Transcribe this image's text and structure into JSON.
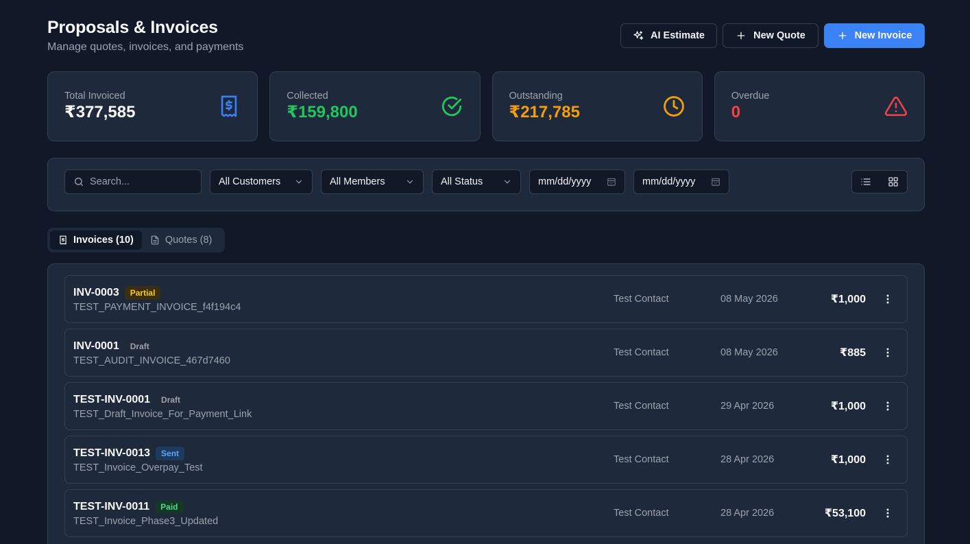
{
  "header": {
    "title": "Proposals & Invoices",
    "subtitle": "Manage quotes, invoices, and payments",
    "ai_estimate_label": "AI Estimate",
    "new_quote_label": "New Quote",
    "new_invoice_label": "New Invoice"
  },
  "stats": [
    {
      "label": "Total Invoiced",
      "value": "₹377,585",
      "color": "#f9fafb",
      "icon": "receipt-icon"
    },
    {
      "label": "Collected",
      "value": "₹159,800",
      "color": "#22c55e",
      "icon": "check-circle-icon"
    },
    {
      "label": "Outstanding",
      "value": "₹217,785",
      "color": "#f59e0b",
      "icon": "clock-icon"
    },
    {
      "label": "Overdue",
      "value": "0",
      "color": "#ef4444",
      "icon": "warning-icon"
    }
  ],
  "filters": {
    "search_placeholder": "Search...",
    "customers": "All Customers",
    "members": "All Members",
    "status": "All Status",
    "date_from_placeholder": "mm/dd/yyyy",
    "date_to_placeholder": "mm/dd/yyyy"
  },
  "tabs": [
    {
      "label": "Invoices (10)",
      "active": true
    },
    {
      "label": "Quotes (8)",
      "active": false
    }
  ],
  "invoices": [
    {
      "number": "INV-0003",
      "status": "Partial",
      "name": "TEST_PAYMENT_INVOICE_f4f194c4",
      "contact": "Test Contact",
      "date": "08 May 2026",
      "amount": "₹1,000"
    },
    {
      "number": "INV-0001",
      "status": "Draft",
      "name": "TEST_AUDIT_INVOICE_467d7460",
      "contact": "Test Contact",
      "date": "08 May 2026",
      "amount": "₹885"
    },
    {
      "number": "TEST-INV-0001",
      "status": "Draft",
      "name": "TEST_Draft_Invoice_For_Payment_Link",
      "contact": "Test Contact",
      "date": "29 Apr 2026",
      "amount": "₹1,000"
    },
    {
      "number": "TEST-INV-0013",
      "status": "Sent",
      "name": "TEST_Invoice_Overpay_Test",
      "contact": "Test Contact",
      "date": "28 Apr 2026",
      "amount": "₹1,000"
    },
    {
      "number": "TEST-INV-0011",
      "status": "Paid",
      "name": "TEST_Invoice_Phase3_Updated",
      "contact": "Test Contact",
      "date": "28 Apr 2026",
      "amount": "₹53,100"
    }
  ]
}
